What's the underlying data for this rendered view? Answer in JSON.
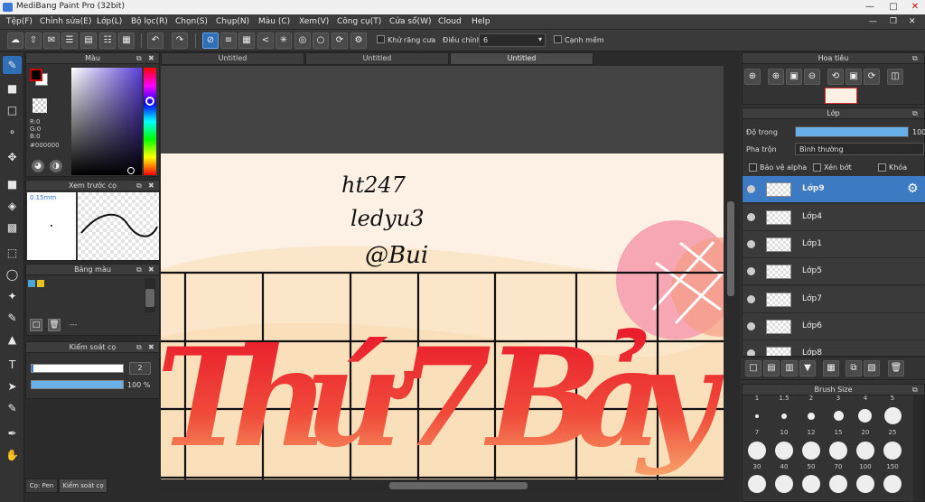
{
  "window": {
    "title": "MediBang Paint Pro (32bit)"
  },
  "menu": [
    "Tệp(F)",
    "Chỉnh sửa(E)",
    "Lớp(L)",
    "Bộ lọc(R)",
    "Chọn(S)",
    "Chụp(N)",
    "Màu (C)",
    "Xem(V)",
    "Công cụ(T)",
    "Cửa sổ(W)",
    "Cloud",
    "Help"
  ],
  "toolbar": {
    "antialias_label": "Khử răng cưa",
    "adjust_label": "Điều chỉnh",
    "adjust_value": "6",
    "soft_edge_label": "Cạnh mềm"
  },
  "color_panel": {
    "title": "Màu",
    "r": "R:0",
    "g": "G:0",
    "b": "B:0",
    "hex": "#000000",
    "fg": "#000000",
    "bg": "#ffffff"
  },
  "brush_preview": {
    "title": "Xem trước cọ",
    "size": "0.15mm"
  },
  "palette": {
    "title": "Bảng màu",
    "footer": "---",
    "swatches": [
      "#4ba3d6",
      "#e8c11c"
    ]
  },
  "brush_control": {
    "title": "Kiểm soát cọ",
    "size_value": "2",
    "opacity_value": "100 %",
    "size_fraction": 0.02,
    "opacity_fraction": 1.0
  },
  "bottom_tabs": [
    "Cọ: Pen",
    "Kiểm soát cọ"
  ],
  "document_tabs": [
    "Untitled",
    "Untitled",
    "Untitled"
  ],
  "canvas": {
    "handwriting": [
      "ht247",
      "ledyu3",
      "@Bui"
    ],
    "lettering": "Thứ 7 Bảy"
  },
  "navigator": {
    "title": "Hoa tiêu"
  },
  "layer_panel": {
    "title": "Lớp",
    "opacity_label": "Độ trong",
    "opacity_value": "100",
    "opacity_fraction": 1.0,
    "blend_label": "Pha trộn",
    "blend_value": "Bình thường",
    "protect_alpha": "Bảo vệ alpha",
    "clipping": "Xén bớt",
    "lock": "Khóa",
    "layers": [
      "Lớp9",
      "Lớp4",
      "Lớp1",
      "Lớp5",
      "Lớp7",
      "Lớp6",
      "Lớp8"
    ],
    "selected": "Lớp9"
  },
  "brush_size": {
    "title": "Brush Size",
    "row1": [
      "1",
      "1.5",
      "2",
      "3",
      "4",
      "5"
    ],
    "row2": [
      "7",
      "10",
      "12",
      "15",
      "20",
      "25"
    ],
    "row3": [
      "30",
      "40",
      "50",
      "70",
      "100",
      "150"
    ]
  },
  "colors": {
    "accent": "#3d7ac4",
    "canvas_bg": "#fdf1e6"
  }
}
